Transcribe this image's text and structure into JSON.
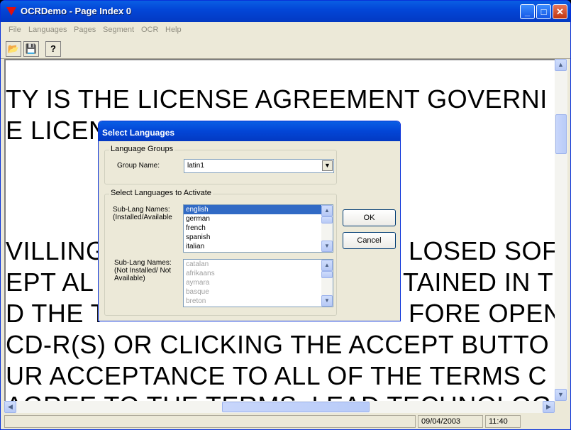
{
  "window": {
    "title": "OCRDemo - Page Index 0",
    "minimize": "_",
    "maximize": "□",
    "close": "✕"
  },
  "menu": [
    "File",
    "Languages",
    "Pages",
    "Segment",
    "OCR",
    "Help"
  ],
  "toolbar": {
    "open_icon": "📂",
    "save_icon": "💾",
    "help_icon": "?"
  },
  "document_lines": [
    "TY IS THE LICENSE AGREEMENT GOVERNI",
    "E LICEN",
    "VILLING",
    "EPT AL",
    "D THE T",
    "CD-R(S) OR CLICKING THE ACCEPT BUTTO",
    "UR ACCEPTANCE TO ALL OF THE TERMS C",
    "AGREE TO THE TERMS, LEAD TECHNOLOG",
    "LOSED SOFT",
    "TAINED IN TH",
    "FORE OPENI"
  ],
  "statusbar": {
    "date": "09/04/2003",
    "time": "11:40"
  },
  "dialog": {
    "title": "Select Languages",
    "group1_label": "Language Groups",
    "group_name_label": "Group Name:",
    "group_name_value": "latin1",
    "group2_label": "Select Languages to Activate",
    "installed_label": "Sub-Lang Names: (Installed/Available",
    "installed_items": [
      "english",
      "german",
      "french",
      "spanish",
      "italian"
    ],
    "notinstalled_label": "Sub-Lang Names: (Not Installed/ Not Available)",
    "notinstalled_items": [
      "catalan",
      "afrikaans",
      "aymara",
      "basque",
      "breton"
    ],
    "ok_label": "OK",
    "cancel_label": "Cancel"
  }
}
